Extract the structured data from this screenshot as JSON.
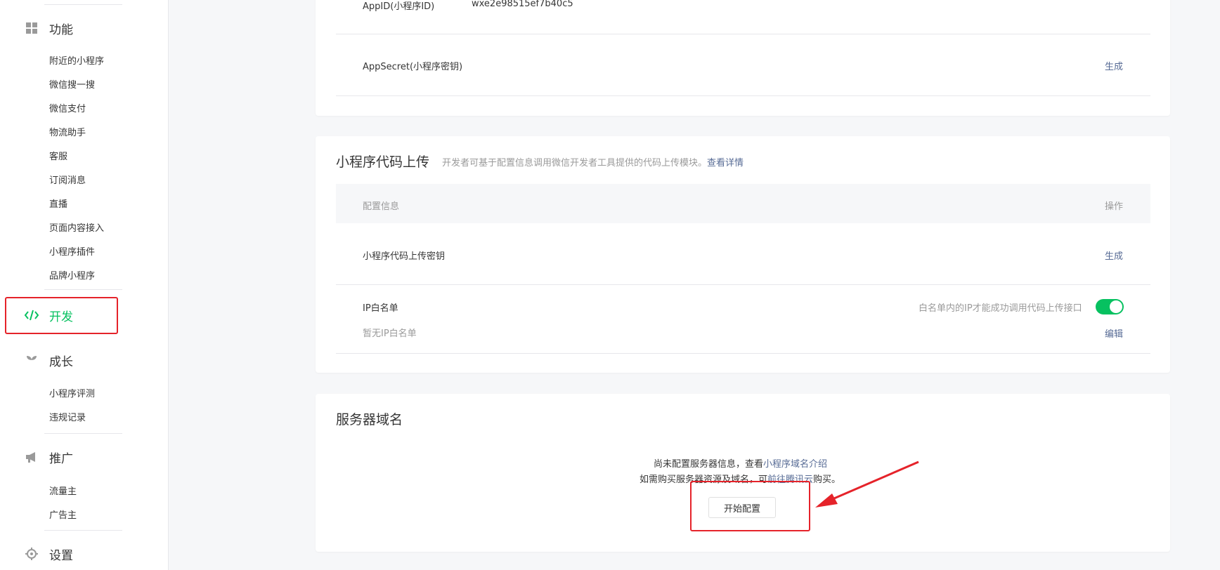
{
  "sidebar": {
    "groups": [
      {
        "key": "function",
        "label": "功能",
        "icon": "grid-icon"
      },
      {
        "key": "develop",
        "label": "开发",
        "icon": "code-icon",
        "active": true
      },
      {
        "key": "growth",
        "label": "成长",
        "icon": "sprout-icon"
      },
      {
        "key": "promote",
        "label": "推广",
        "icon": "megaphone-icon"
      },
      {
        "key": "settings",
        "label": "设置",
        "icon": "gear-icon"
      }
    ],
    "function_items": [
      "附近的小程序",
      "微信搜一搜",
      "微信支付",
      "物流助手",
      "客服",
      "订阅消息",
      "直播",
      "页面内容接入",
      "小程序插件",
      "品牌小程序"
    ],
    "growth_items": [
      "小程序评测",
      "违规记录"
    ],
    "promote_items": [
      "流量主",
      "广告主"
    ]
  },
  "dev_settings": {
    "appid_label": "AppID(小程序ID)",
    "appid_value": "wxe2e98515ef7b40c5",
    "appsecret_label": "AppSecret(小程序密钥)",
    "appsecret_action": "生成"
  },
  "code_upload": {
    "title": "小程序代码上传",
    "desc": "开发者可基于配置信息调用微信开发者工具提供的代码上传模块。",
    "desc_link": "查看详情",
    "col_config": "配置信息",
    "col_action": "操作",
    "key_label": "小程序代码上传密钥",
    "key_action": "生成",
    "ip_label": "IP白名单",
    "ip_empty": "暂无IP白名单",
    "ip_hint": "白名单内的IP才能成功调用代码上传接口",
    "ip_toggle_on": true,
    "ip_action": "编辑"
  },
  "server_domain": {
    "title": "服务器域名",
    "line1_prefix": "尚未配置服务器信息，查看",
    "line1_link": "小程序域名介绍",
    "line2_prefix": "如需购买服务器资源及域名，可",
    "line2_link": "前往腾讯云",
    "line2_suffix": "购买。",
    "button": "开始配置"
  },
  "colors": {
    "accent": "#07c160",
    "link": "#576b95",
    "annotation": "#e5232a"
  }
}
